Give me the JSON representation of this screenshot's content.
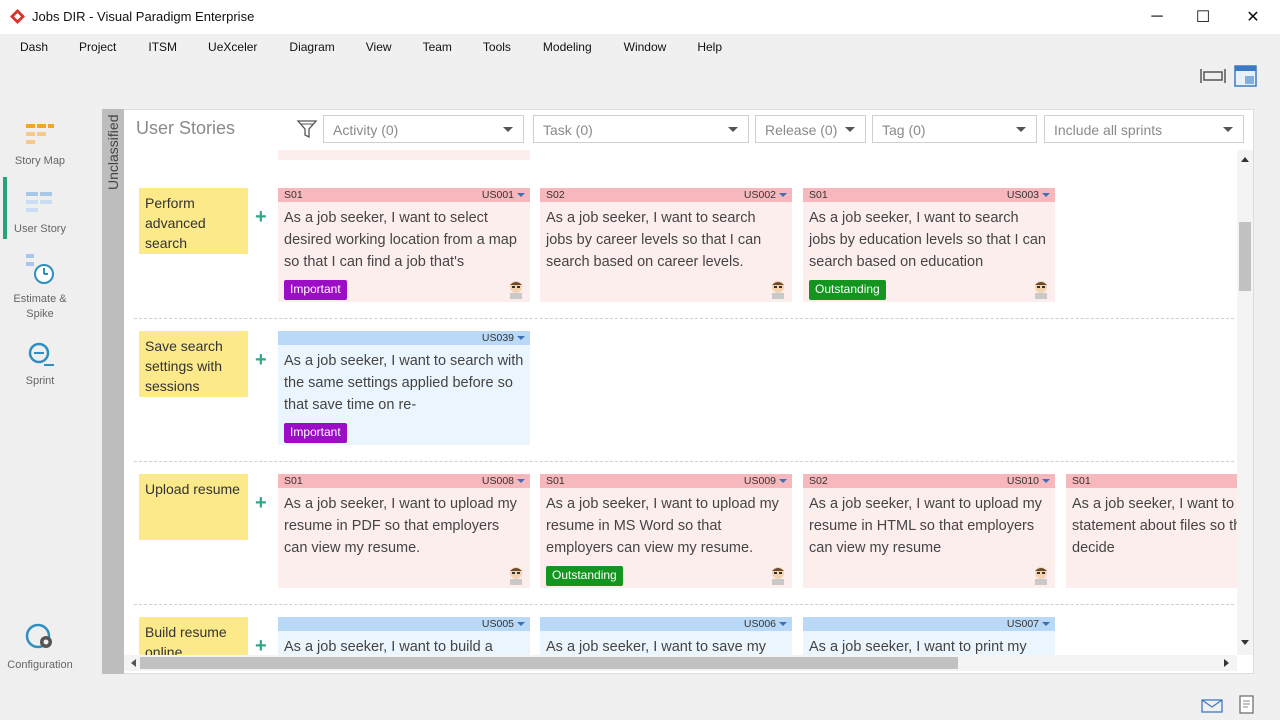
{
  "window": {
    "title": "Jobs DIR - Visual Paradigm Enterprise",
    "min": "─",
    "max": "☐",
    "close": "✕"
  },
  "menu": [
    "Dash",
    "Project",
    "ITSM",
    "UeXceler",
    "Diagram",
    "View",
    "Team",
    "Tools",
    "Modeling",
    "Window",
    "Help"
  ],
  "nav": {
    "story_map": "Story Map",
    "user_story": "User Story",
    "estimate": "Estimate &\nSpike",
    "sprint": "Sprint",
    "configuration": "Configuration"
  },
  "panel": {
    "side_label": "Unclassified",
    "title": "User Stories",
    "filters": {
      "activity": "Activity (0)",
      "task": "Task (0)",
      "release": "Release (0)",
      "tag": "Tag (0)",
      "sprints": "Include all sprints"
    }
  },
  "colors": {
    "accent": "#29a37f",
    "important": "#9b0ec6",
    "outstanding": "#13951f",
    "epic": "#fbe98a"
  },
  "rows": [
    {
      "epic": "Perform advanced search",
      "cards": [
        {
          "sprint": "S01",
          "id": "US001",
          "text": "As a job seeker, I want to select desired working location from a map so that I can find a job that's",
          "tag": "Important",
          "color": "pink"
        },
        {
          "sprint": "S02",
          "id": "US002",
          "text": "As a job seeker, I want to search jobs by career levels so that I can search based on career levels.",
          "tag": "",
          "color": "pink"
        },
        {
          "sprint": "S01",
          "id": "US003",
          "text": "As a job seeker, I want to search jobs by education levels so that I can search based on education",
          "tag": "Outstanding",
          "color": "pink"
        }
      ]
    },
    {
      "epic": "Save search settings with sessions",
      "cards": [
        {
          "sprint": "",
          "id": "US039",
          "text": "As a job seeker, I want to search with the same settings applied before so that save time on re-",
          "tag": "Important",
          "color": "blue"
        }
      ]
    },
    {
      "epic": "Upload resume",
      "cards": [
        {
          "sprint": "S01",
          "id": "US008",
          "text": "As a job seeker, I want to upload my resume in PDF so that employers can view my resume.",
          "tag": "",
          "color": "pink"
        },
        {
          "sprint": "S01",
          "id": "US009",
          "text": "As a job seeker, I want to upload my resume in MS Word so that employers can view my resume.",
          "tag": "Outstanding",
          "color": "pink"
        },
        {
          "sprint": "S02",
          "id": "US010",
          "text": "As a job seeker, I want to upload my resume in HTML so that employers can view my resume",
          "tag": "",
          "color": "pink"
        },
        {
          "sprint": "S01",
          "id": "",
          "text": "As a job seeker, I want to privacy statement about files so that I can decide",
          "tag": "",
          "color": "pink"
        }
      ]
    },
    {
      "epic": "Build resume online",
      "cards": [
        {
          "sprint": "",
          "id": "US005",
          "text": "As a job seeker, I want to build a",
          "tag": "",
          "color": "blue"
        },
        {
          "sprint": "",
          "id": "US006",
          "text": "As a job seeker, I want to save my",
          "tag": "",
          "color": "blue"
        },
        {
          "sprint": "",
          "id": "US007",
          "text": "As a job seeker, I want to print my",
          "tag": "",
          "color": "blue"
        }
      ]
    }
  ]
}
